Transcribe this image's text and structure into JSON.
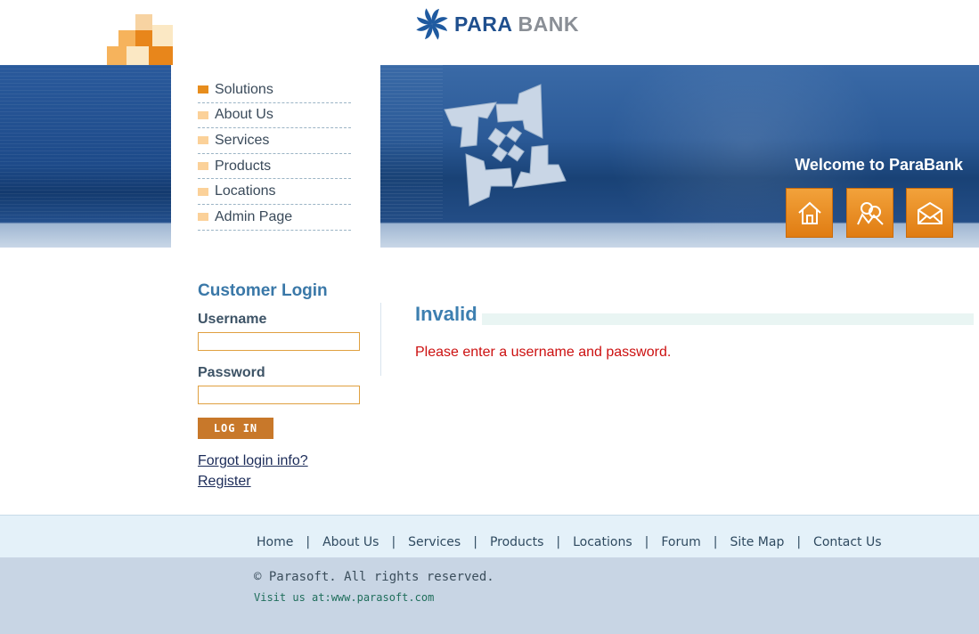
{
  "brand": {
    "name_part1": "PARA",
    "name_part2": "BANK",
    "accent": "#e07c12",
    "primary": "#1f4f8e"
  },
  "header": {
    "welcome": "Welcome to ParaBank",
    "buttons": [
      "home-icon",
      "contact-people-icon",
      "mail-icon"
    ]
  },
  "leftmenu": {
    "items": [
      {
        "label": "Solutions",
        "active": true
      },
      {
        "label": "About Us"
      },
      {
        "label": "Services"
      },
      {
        "label": "Products"
      },
      {
        "label": "Locations"
      },
      {
        "label": "Admin Page"
      }
    ]
  },
  "login": {
    "title": "Customer Login",
    "username_label": "Username",
    "username_value": "",
    "password_label": "Password",
    "password_value": "",
    "button": "LOG IN",
    "forgot": "Forgot login info?",
    "register": "Register"
  },
  "main": {
    "title": "Invalid",
    "error": "Please enter a username and password.",
    "error_color": "#cc1010"
  },
  "footer": {
    "links": [
      "Home",
      "About Us",
      "Services",
      "Products",
      "Locations",
      "Forum",
      "Site Map",
      "Contact Us"
    ],
    "separator": "|",
    "copyright": "© Parasoft. All rights reserved.",
    "visit_prefix": "Visit us at:",
    "visit_link": "www.parasoft.com"
  }
}
